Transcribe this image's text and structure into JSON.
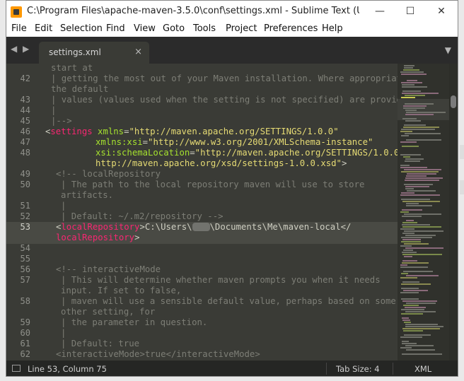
{
  "window": {
    "title": "C:\\Program Files\\apache-maven-3.5.0\\conf\\settings.xml - Sublime Text (UNREGISTERED)",
    "minimize": "—",
    "maximize": "☐",
    "close": "✕"
  },
  "menu": [
    "File",
    "Edit",
    "Selection",
    "Find",
    "View",
    "Goto",
    "Tools",
    "Project",
    "Preferences",
    "Help"
  ],
  "tab": {
    "label": "settings.xml",
    "close": "×"
  },
  "code": {
    "l42": "42",
    "l43": "43",
    "l44": "44",
    "l45": "45",
    "l46": "46",
    "l47": "47",
    "l48": "48",
    "l49": "49",
    "l50": "50",
    "l51": "51",
    "l52": "52",
    "l53": "53",
    "l54": "54",
    "l55": "55",
    "l56": "56",
    "l57": "57",
    "l58": "58",
    "l59": "59",
    "l60": "60",
    "l61": "61",
    "l62": "62",
    "c_start_at": "start at",
    "c42a": "| getting the most out of your Maven installation. Where appropriate,",
    "c42b": "the default",
    "c43": "| values (values used when the setting is not specified) are provided.",
    "c44": "|",
    "c45": "|-->",
    "lt": "<",
    "gt": ">",
    "eq": "=",
    "settings_tag": "settings",
    "xmlns_attr": "xmlns",
    "xmlns_val": "\"http://maven.apache.org/SETTINGS/1.0.0\"",
    "xsi_attr": "xmlns:xsi",
    "xsi_val": "\"http://www.w3.org/2001/XMLSchema-instance\"",
    "schema_attr": "xsi:schemaLocation",
    "schema_val_a": "\"http://maven.apache.org/SETTINGS/1.0.0",
    "schema_val_b": "http://maven.apache.org/xsd/settings-1.0.0.xsd\"",
    "c49": "<!-- localRepository",
    "c50a": "| The path to the local repository maven will use to store",
    "c50b": "artifacts.",
    "c51": "|",
    "c52": "| Default: ~/.m2/repository -->",
    "lr_tag": "localRepository",
    "lr_text_a": "C:\\Users\\",
    "lr_text_b": "\\Documents\\Me\\maven-local",
    "lt_close": "</",
    "c56": "<!-- interactiveMode",
    "c57a": "| This will determine whether maven prompts you when it needs",
    "c57b": "input. If set to false,",
    "c58a": "| maven will use a sensible default value, perhaps based on some",
    "c58b": "other setting, for",
    "c59": "| the parameter in question.",
    "c60": "|",
    "c61": "| Default: true",
    "c62": "<interactiveMode>true</interactiveMode>"
  },
  "status": {
    "position": "Line 53, Column 75",
    "tab_size": "Tab Size: 4",
    "syntax": "XML"
  },
  "colors": {
    "editor_bg": "#3a3b36",
    "tag": "#f92672",
    "attribute": "#a6e22e",
    "string": "#e6db74",
    "comment": "#7d7e76"
  }
}
